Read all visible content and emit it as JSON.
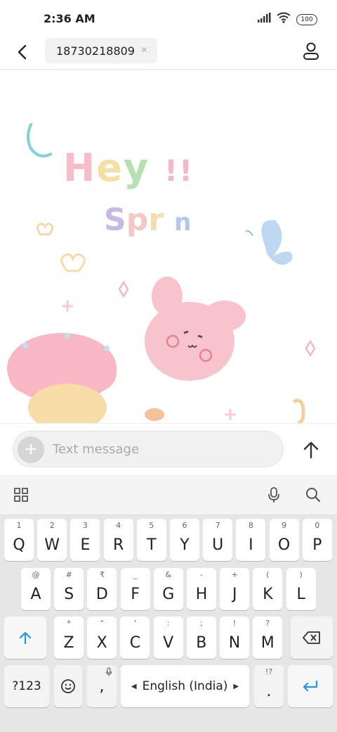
{
  "status_bar": {
    "time": "2:36 AM",
    "battery": "100"
  },
  "header": {
    "recipient": "18730218809",
    "clear_symbol": "×"
  },
  "background": {
    "text_hey": "Hey !!",
    "text_spr": "Spr n"
  },
  "composer": {
    "placeholder": "Text message",
    "attach_symbol": "+"
  },
  "keyboard": {
    "row1": [
      {
        "hint": "1",
        "label": "Q"
      },
      {
        "hint": "2",
        "label": "W"
      },
      {
        "hint": "3",
        "label": "E"
      },
      {
        "hint": "4",
        "label": "R"
      },
      {
        "hint": "5",
        "label": "T"
      },
      {
        "hint": "6",
        "label": "Y"
      },
      {
        "hint": "7",
        "label": "U"
      },
      {
        "hint": "8",
        "label": "I"
      },
      {
        "hint": "9",
        "label": "O"
      },
      {
        "hint": "0",
        "label": "P"
      }
    ],
    "row2": [
      {
        "hint": "@",
        "label": "A"
      },
      {
        "hint": "#",
        "label": "S"
      },
      {
        "hint": "₹",
        "label": "D"
      },
      {
        "hint": "_",
        "label": "F"
      },
      {
        "hint": "&",
        "label": "G"
      },
      {
        "hint": "-",
        "label": "H"
      },
      {
        "hint": "+",
        "label": "J"
      },
      {
        "hint": "(",
        "label": "K"
      },
      {
        "hint": ")",
        "label": "L"
      }
    ],
    "row3": [
      {
        "hint": "*",
        "label": "Z"
      },
      {
        "hint": "\"",
        "label": "X"
      },
      {
        "hint": "'",
        "label": "C"
      },
      {
        "hint": ":",
        "label": "V"
      },
      {
        "hint": ";",
        "label": "B"
      },
      {
        "hint": "!",
        "label": "N"
      },
      {
        "hint": "?",
        "label": "M"
      }
    ],
    "symbols_key": "?123",
    "comma_key": ",",
    "space_label": "English (India)",
    "period_hint": "!?",
    "period_key": "."
  },
  "colors": {
    "accent": "#2196f3"
  }
}
